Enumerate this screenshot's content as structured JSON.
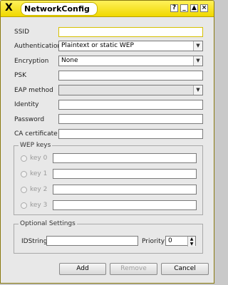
{
  "window": {
    "title": "NetworkConfig",
    "app_icon": "X"
  },
  "title_buttons": {
    "help": "?",
    "minimize": "_",
    "maximize": "▲",
    "close": "×"
  },
  "fields": {
    "ssid": {
      "label": "SSID",
      "value": ""
    },
    "authentication": {
      "label": "Authentication",
      "value": "Plaintext or static WEP"
    },
    "encryption": {
      "label": "Encryption",
      "value": "None"
    },
    "psk": {
      "label": "PSK",
      "value": ""
    },
    "eap_method": {
      "label": "EAP method",
      "value": ""
    },
    "identity": {
      "label": "Identity",
      "value": ""
    },
    "password": {
      "label": "Password",
      "value": ""
    },
    "ca_certificate": {
      "label": "CA certificate",
      "value": ""
    }
  },
  "wep_keys": {
    "title": "WEP keys",
    "keys": [
      {
        "label": "key 0",
        "value": ""
      },
      {
        "label": "key 1",
        "value": ""
      },
      {
        "label": "key 2",
        "value": ""
      },
      {
        "label": "key 3",
        "value": ""
      }
    ]
  },
  "optional": {
    "title": "Optional Settings",
    "idstring_label": "IDString",
    "idstring_value": "",
    "priority_label": "Priority",
    "priority_value": "0"
  },
  "buttons": {
    "add": "Add",
    "remove": "Remove",
    "cancel": "Cancel"
  },
  "colors": {
    "titlebar": "#f7e400",
    "window_bg": "#e8e8e8"
  }
}
